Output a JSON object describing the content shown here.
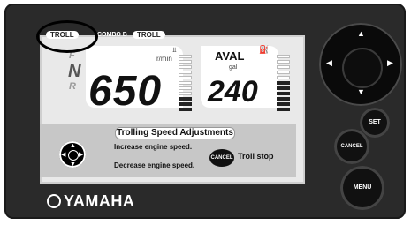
{
  "device": {
    "brand": "YAMAHA"
  },
  "screen": {
    "mode_chips": [
      "TROLL",
      "COMBO B",
      "TROLL"
    ],
    "gears": [
      "F",
      "N",
      "R"
    ],
    "rpm": {
      "unit": "r/min",
      "value": "650"
    },
    "fuel": {
      "label": "AVAL",
      "unit": "gal",
      "value": "240"
    }
  },
  "help_panel": {
    "title": "Trolling Speed Adjustments",
    "increase_text": "Increase engine speed.",
    "decrease_text": "Decrease engine speed.",
    "cancel_label": "CANCEL",
    "cancel_text": "Troll stop"
  },
  "controls": {
    "set_label": "SET",
    "cancel_label": "CANCEL",
    "menu_label": "MENU"
  }
}
